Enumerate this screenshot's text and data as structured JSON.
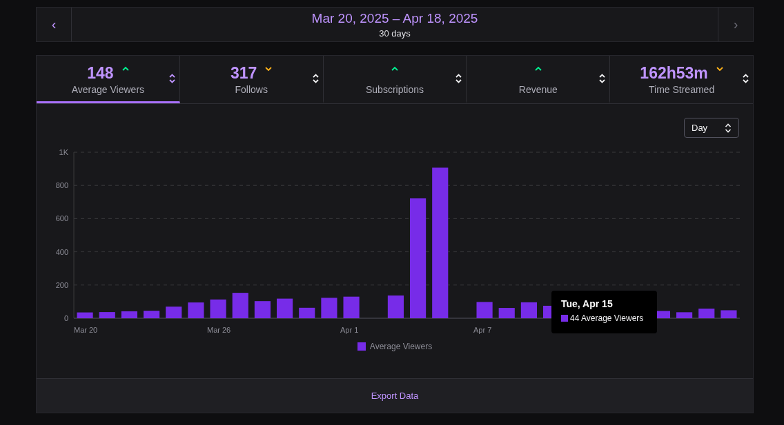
{
  "date_range": {
    "title": "Mar 20, 2025 – Apr 18, 2025",
    "subtitle": "30 days",
    "prev_label": "‹",
    "next_label": "›"
  },
  "metric_tabs": [
    {
      "value": "148",
      "trending_up": true,
      "label": "Average Viewers",
      "selected": true
    },
    {
      "value": "317",
      "trending_up": false,
      "label": "Follows",
      "selected": false
    },
    {
      "trending_up": true,
      "label": "Subscriptions",
      "selected": false
    },
    {
      "trending_up": true,
      "label": "Revenue",
      "selected": false
    },
    {
      "value": "162h53m",
      "trending_up": false,
      "label": "Time Streamed",
      "selected": false
    }
  ],
  "interval_select": {
    "value": "Day"
  },
  "chart": {
    "chart_data": {
      "type": "bar",
      "series": [
        {
          "name": "Average Viewers",
          "color": "#772ce8",
          "values": [
            35,
            37,
            42,
            45,
            70,
            95,
            113,
            153,
            103,
            118,
            63,
            123,
            130,
            null,
            137,
            722,
            907,
            null,
            98,
            62,
            96,
            75,
            null,
            null,
            null,
            null,
            44,
            36,
            58,
            48
          ]
        }
      ],
      "ylim": [
        0,
        1000
      ],
      "yticks": [
        0,
        200,
        400,
        600,
        800,
        {
          "value": 1000,
          "label": "1K"
        }
      ],
      "grid": true,
      "categories": [
        "Mar 20",
        null,
        null,
        null,
        null,
        null,
        "Mar 26",
        null,
        null,
        null,
        null,
        null,
        "Apr 1",
        null,
        null,
        null,
        null,
        null,
        "Apr 7",
        null,
        null,
        null,
        null,
        null,
        null,
        null,
        null,
        null,
        null,
        null
      ]
    },
    "tooltip": {
      "title": "Tue, Apr 15",
      "text": "44 Average Viewers"
    }
  },
  "footer": {
    "button": "Export Data"
  }
}
